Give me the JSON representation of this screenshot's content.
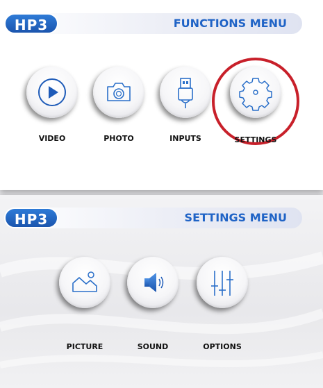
{
  "colors": {
    "brand_blue": "#1f63c6",
    "highlight_red": "#c8202a"
  },
  "functions_menu": {
    "logo_text": "HP3",
    "title": "FUNCTIONS MENU",
    "items": [
      {
        "label": "VIDEO",
        "icon": "play-icon"
      },
      {
        "label": "PHOTO",
        "icon": "camera-icon"
      },
      {
        "label": "INPUTS",
        "icon": "usb-plug-icon"
      },
      {
        "label": "SETTINGS",
        "icon": "gear-icon",
        "highlighted": true
      }
    ]
  },
  "settings_menu": {
    "logo_text": "HP3",
    "title": "SETTINGS MENU",
    "items": [
      {
        "label": "PICTURE",
        "icon": "picture-icon"
      },
      {
        "label": "SOUND",
        "icon": "speaker-icon"
      },
      {
        "label": "OPTIONS",
        "icon": "sliders-icon"
      }
    ]
  }
}
